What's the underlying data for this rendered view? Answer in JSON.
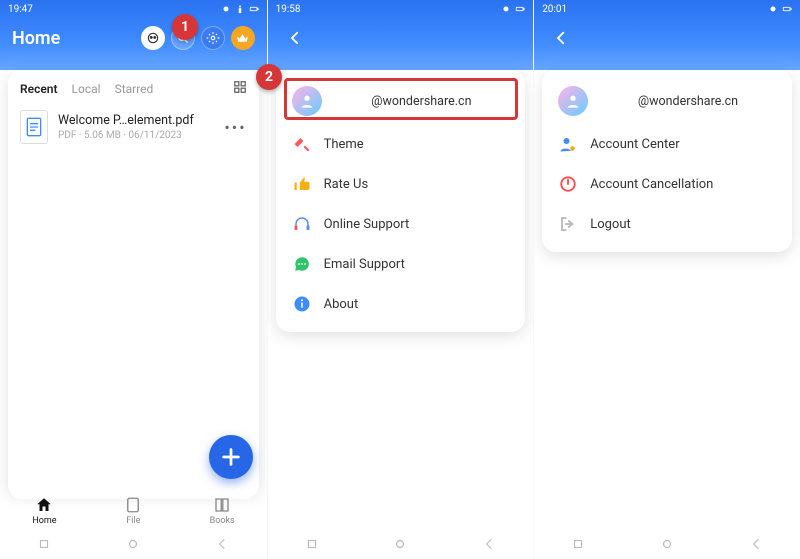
{
  "screen1": {
    "status_time": "19:47",
    "title": "Home",
    "tabs": [
      "Recent",
      "Local",
      "Starred"
    ],
    "file": {
      "name": "Welcome P…element.pdf",
      "meta": "PDF · 5.06 MB · 06/11/2023"
    },
    "bottom": [
      {
        "label": "Home"
      },
      {
        "label": "File"
      },
      {
        "label": "Books"
      }
    ]
  },
  "screen2": {
    "status_time": "19:58",
    "account_email": "@wondershare.cn",
    "items": [
      {
        "label": "Theme"
      },
      {
        "label": "Rate Us"
      },
      {
        "label": "Online Support"
      },
      {
        "label": "Email Support"
      },
      {
        "label": "About"
      }
    ]
  },
  "screen3": {
    "status_time": "20:01",
    "account_email": "@wondershare.cn",
    "items": [
      {
        "label": "Account Center"
      },
      {
        "label": "Account Cancellation"
      },
      {
        "label": "Logout"
      }
    ]
  },
  "callouts": {
    "one": "1",
    "two": "2"
  }
}
